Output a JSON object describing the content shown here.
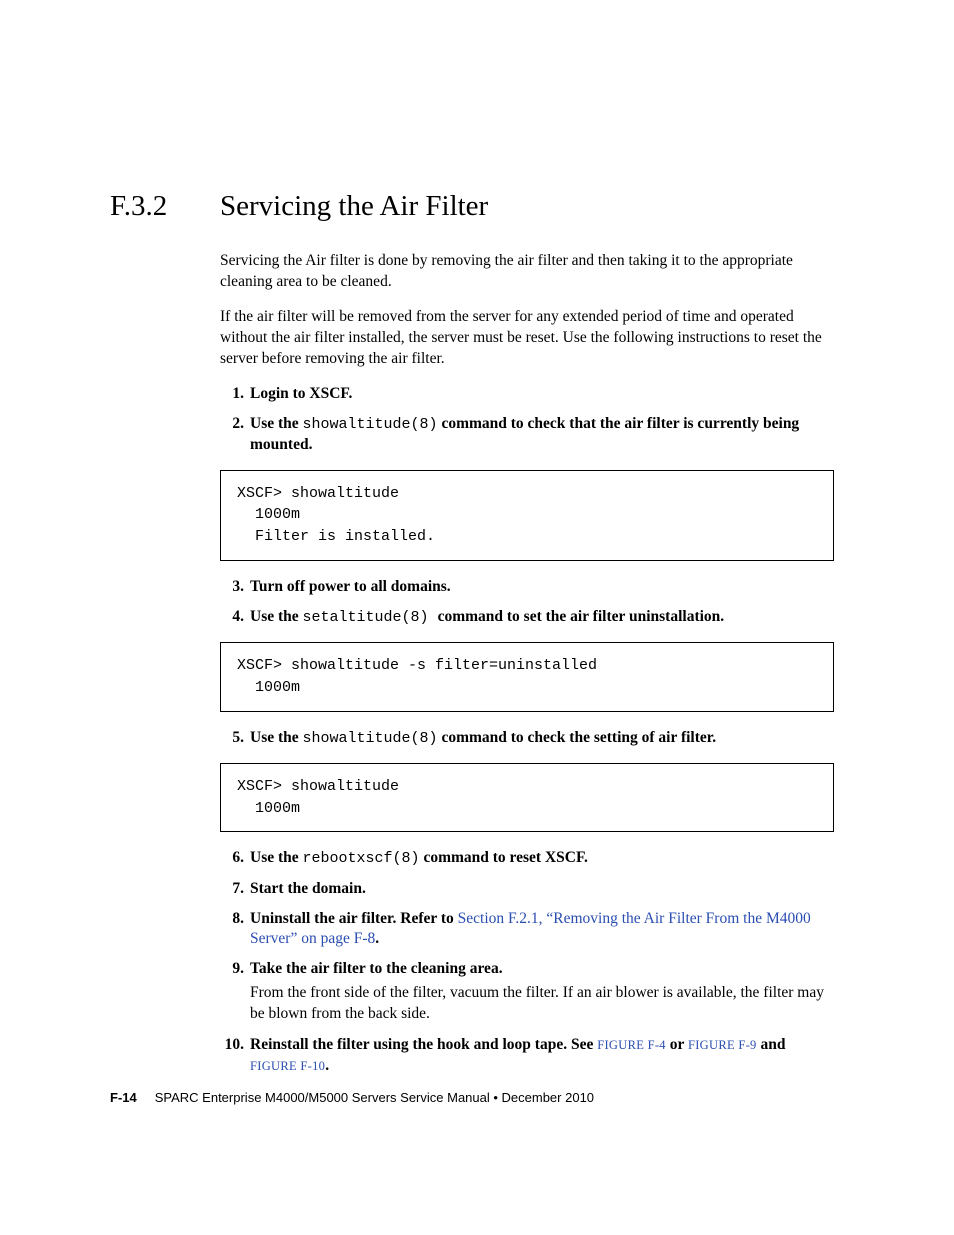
{
  "heading": {
    "number": "F.3.2",
    "title": "Servicing the Air Filter"
  },
  "intro": {
    "p1": "Servicing the Air filter is done by removing the air filter and then taking it to the appropriate cleaning area to be cleaned.",
    "p2": "If the air filter will be removed from the server for any extended period of time and operated without the air filter installed, the server must be reset. Use the following instructions to reset the server before removing the air filter."
  },
  "steps": {
    "s1": {
      "num": "1.",
      "b1": "Login to XSCF."
    },
    "s2": {
      "num": "2.",
      "b1": "Use the ",
      "cmd": "showaltitude(8)",
      "b2": " command to check that the air filter is currently being mounted."
    },
    "code1": "XSCF> showaltitude\n  1000m\n  Filter is installed.",
    "s3": {
      "num": "3.",
      "b1": "Turn off power to all domains."
    },
    "s4": {
      "num": "4.",
      "b1": "Use the ",
      "cmd": "setaltitude(8) ",
      "b2": " command to set the air filter uninstallation."
    },
    "code2": "XSCF> showaltitude -s filter=uninstalled\n  1000m",
    "s5": {
      "num": "5.",
      "b1": "Use the ",
      "cmd": "showaltitude(8)",
      "b2": " command to check the setting of air filter."
    },
    "code3": "XSCF> showaltitude\n  1000m",
    "s6": {
      "num": "6.",
      "b1": "Use the ",
      "cmd": "rebootxscf(8)",
      "b2": " command to reset XSCF."
    },
    "s7": {
      "num": "7.",
      "b1": "Start the domain."
    },
    "s8": {
      "num": "8.",
      "b1": "Uninstall the air filter. Refer to ",
      "link": "Section F.2.1, “Removing the Air Filter From the M4000 Server” on page F-8",
      "b2": "."
    },
    "s9": {
      "num": "9.",
      "b1": "Take the air filter to the cleaning area.",
      "sub": "From the front side of the filter, vacuum the filter. If an air blower is available, the filter may be blown from the back side."
    },
    "s10": {
      "num": "10.",
      "b1": "Reinstall the filter using the hook and loop tape. See ",
      "l1": "FIGURE F-4",
      "mid1": " or ",
      "l2": "FIGURE F-9",
      "mid2": " and ",
      "l3": "FIGURE F-10",
      "b2": "."
    }
  },
  "footer": {
    "page": "F-14",
    "text": "SPARC Enterprise M4000/M5000 Servers Service Manual • December 2010"
  }
}
